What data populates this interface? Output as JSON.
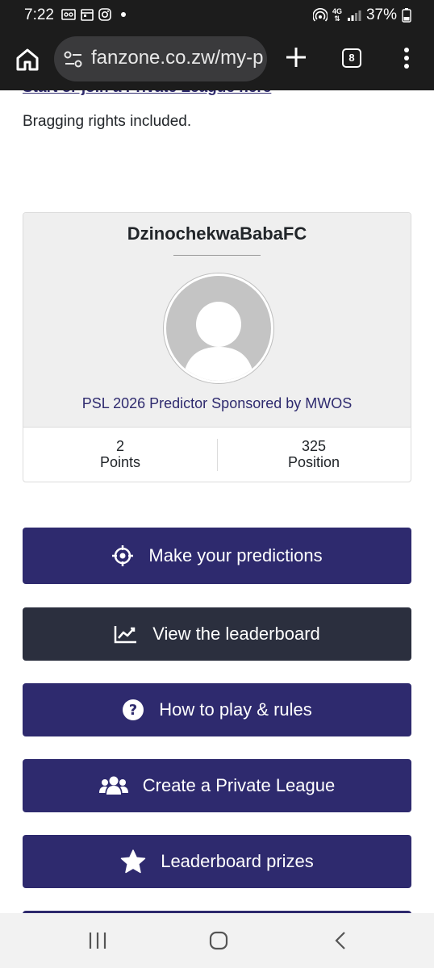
{
  "status_bar": {
    "time": "7:22",
    "battery_percent": "37%",
    "network": "4G"
  },
  "browser": {
    "url": "fanzone.co.zw/my-p",
    "tab_count": "8"
  },
  "page": {
    "cut_off_link": "Start or join a Private League here",
    "tagline": "Bragging rights included."
  },
  "profile_card": {
    "team_name": "DzinochekwaBabaFC",
    "league": "PSL 2026 Predictor Sponsored by MWOS",
    "points_value": "2",
    "points_label": "Points",
    "position_value": "325",
    "position_label": "Position"
  },
  "actions": {
    "predictions": "Make your predictions",
    "leaderboard": "View the leaderboard",
    "rules": "How to play & rules",
    "private_league": "Create a Private League",
    "prizes": "Leaderboard prizes"
  },
  "colors": {
    "primary": "#2e2a6e",
    "dark_button": "#2b2f3e",
    "card_bg": "#efefef"
  }
}
